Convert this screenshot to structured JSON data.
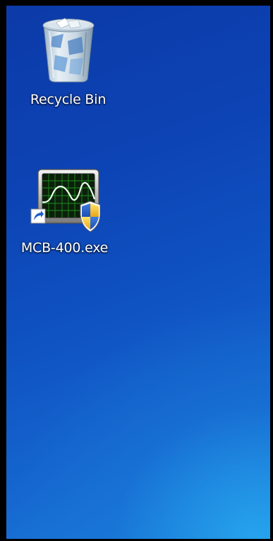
{
  "desktop": {
    "icons": [
      {
        "label": "Recycle Bin",
        "icon": "recycle-bin-icon"
      },
      {
        "label": "MCB-400.exe",
        "icon": "oscilloscope-app-icon",
        "overlays": [
          "shortcut-arrow-icon",
          "uac-shield-icon"
        ]
      }
    ]
  },
  "colors": {
    "desktop_top": "#0c3aa8",
    "desktop_bottom_right": "#28aaf0",
    "frame": "#000000",
    "label_text": "#ffffff"
  }
}
